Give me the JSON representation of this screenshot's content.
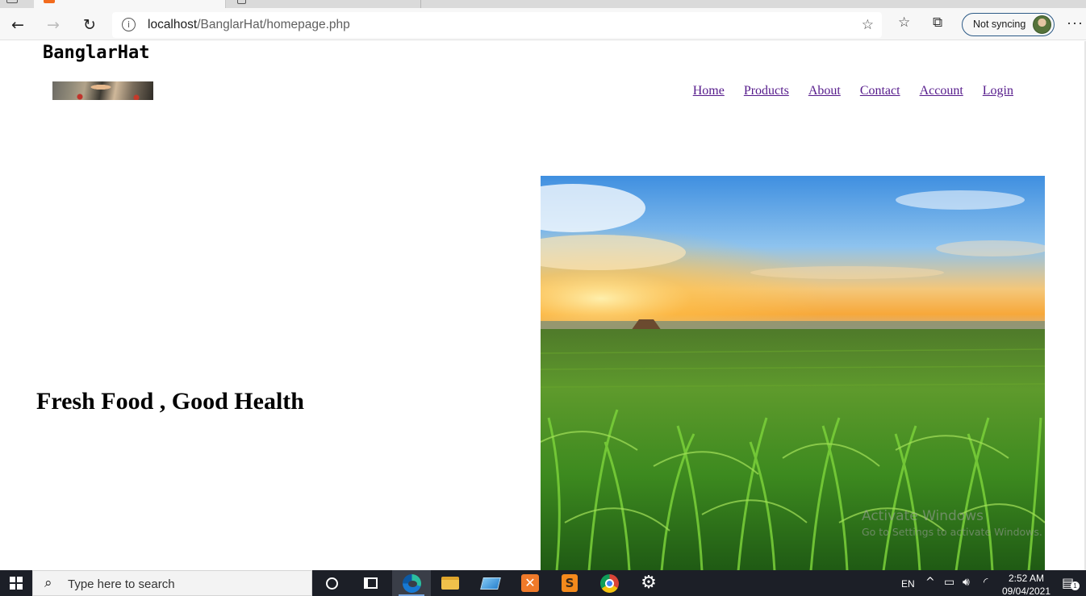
{
  "browser": {
    "address_host": "localhost",
    "address_path": "/BanglarHat/homepage.php",
    "info_glyph": "i",
    "sync_label": "Not syncing",
    "more_label": "···"
  },
  "site": {
    "brand": "BanglarHat",
    "nav": [
      "Home",
      "Products",
      "About",
      "Contact",
      "Account",
      "Login"
    ],
    "hero_title": "Fresh Food , Good Health"
  },
  "watermark": {
    "line1": "Activate Windows",
    "line2": "Go to Settings to activate Windows."
  },
  "taskbar": {
    "search_placeholder": "Type here to search",
    "lang": "EN",
    "time": "2:52 AM",
    "date": "09/04/2021",
    "notification_count": "1"
  },
  "colors": {
    "link": "#551a8b",
    "taskbar": "#1c1f27",
    "sync_border": "#2d5b87"
  }
}
